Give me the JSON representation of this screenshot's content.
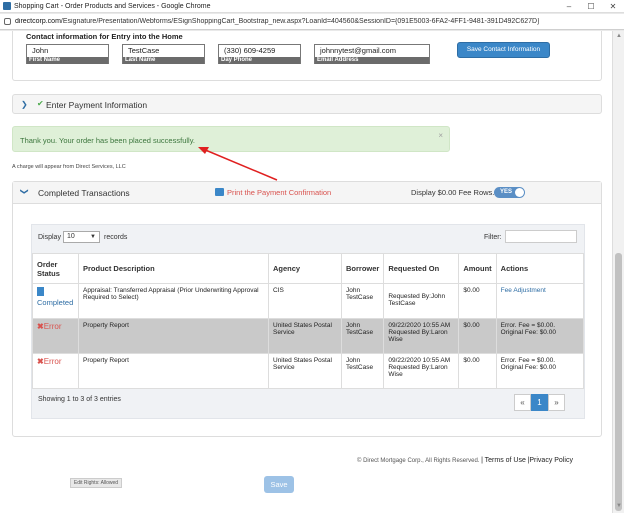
{
  "browser": {
    "window_title": "Shopping Cart - Order Products and Services - Google Chrome",
    "url_host": "directcorp.com",
    "url_path": "/Esignature/Presentation/Webforms/ESignShoppingCart_Bootstrap_new.aspx?LoanId=404560&SessionID={091E5003-6FA2-4FF1-9481-391D492C627D}"
  },
  "contact": {
    "title": "Contact information for Entry into the Home",
    "first_name": {
      "value": "John",
      "label": "First Name"
    },
    "last_name": {
      "value": "TestCase",
      "label": "Last Name"
    },
    "day_phone": {
      "value": "(330) 609-4259",
      "label": "Day Phone"
    },
    "email": {
      "value": "johnnytest@gmail.com",
      "label": "Email Address"
    },
    "save_label": "Save Contact Information"
  },
  "payment": {
    "label": "Enter Payment Information"
  },
  "alert": {
    "message": "Thank you. Your order has been placed successfully.",
    "close": "×"
  },
  "charge_note": "A charge will appear from Direct Services, LLC",
  "transactions": {
    "title": "Completed Transactions",
    "print_label": "Print the Payment Confirmation",
    "fee_rows_label": "Display $0.00 Fee Rows.",
    "toggle_label": "YES",
    "display_label": "Display",
    "page_size": "10",
    "records_label": "records",
    "filter_label": "Filter:",
    "columns": [
      "Order Status",
      "Product Description",
      "Agency",
      "Borrower",
      "Requested On",
      "Amount",
      "Actions"
    ],
    "rows": [
      {
        "status": "Completed",
        "product": "Appraisal: Transferred Appraisal (Prior Underwriting Approval Required to Select)",
        "agency": "CIS",
        "borrower": "John TestCase",
        "requested_on": "",
        "requested_by": "Requested By:John TestCase",
        "amount": "$0.00",
        "action": "Fee Adjustment"
      },
      {
        "status": "Error",
        "product": "Property Report",
        "agency": "United States Postal Service",
        "borrower": "John TestCase",
        "requested_on": "09/22/2020 10:55 AM",
        "requested_by": "Requested By:Laron Wise",
        "amount": "$0.00",
        "action": "Error. Fee = $0.00. Original Fee: $0.00"
      },
      {
        "status": "Error",
        "product": "Property Report",
        "agency": "United States Postal Service",
        "borrower": "John TestCase",
        "requested_on": "09/22/2020 10:55 AM",
        "requested_by": "Requested By:Laron Wise",
        "amount": "$0.00",
        "action": "Error. Fee = $0.00. Original Fee: $0.00"
      }
    ],
    "info": "Showing 1 to 3 of 3 entries",
    "pager": {
      "prev": "«",
      "current": "1",
      "next": "»"
    }
  },
  "footer": {
    "copyright": "© Direct Mortgage Corp., All Rights Reserved.",
    "terms": "Terms of Use",
    "privacy": "Privacy Policy",
    "sep": "|"
  },
  "edit_rights": "Edit Rights: Allowed",
  "save_label": "Save",
  "colors": {
    "accent": "#3b87c8",
    "success_bg": "#dff0d8",
    "error": "#d9534f",
    "arrow": "#e02020"
  }
}
